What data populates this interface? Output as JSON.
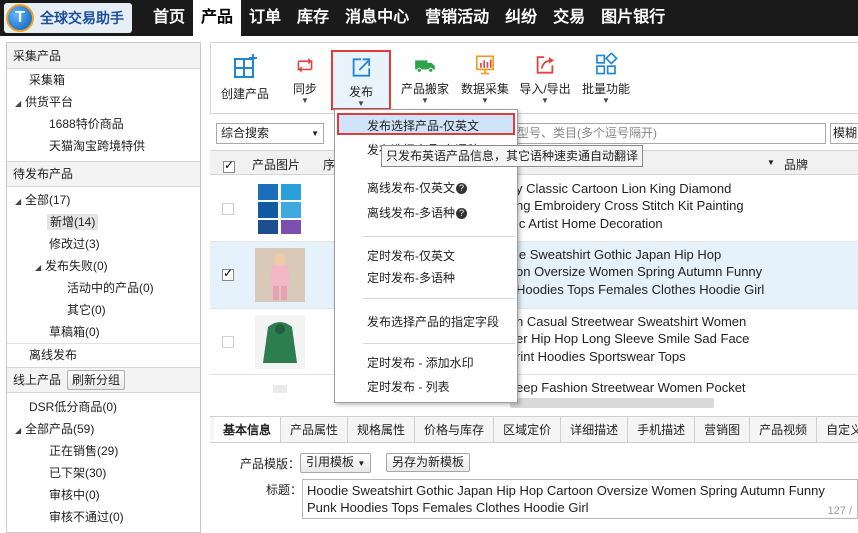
{
  "app": {
    "logo_text": "全球交易助手",
    "logo_mark": "T"
  },
  "nav": [
    "首页",
    "产品",
    "订单",
    "库存",
    "消息中心",
    "营销活动",
    "纠纷",
    "交易",
    "图片银行"
  ],
  "sidebar": {
    "collect_header": "采集产品",
    "collect_items": [
      "采集箱",
      "供货平台",
      "1688特价商品",
      "天猫淘宝跨境特供"
    ],
    "pending_header": "待发布产品",
    "pending_items": [
      "全部(17)",
      "新增(14)",
      "修改过(3)",
      "发布失败(0)",
      "活动中的产品(0)",
      "其它(0)",
      "草稿箱(0)"
    ],
    "offline": "离线发布",
    "online_header": "线上产品",
    "refresh_btn": "刷新分组",
    "online_items": [
      "DSR低分商品(0)",
      "全部产品(59)",
      "正在销售(29)",
      "已下架(30)",
      "审核中(0)",
      "审核不通过(0)"
    ]
  },
  "toolbar": {
    "create": "创建产品",
    "sync": "同步",
    "publish": "发布",
    "move": "产品搬家",
    "data_collect": "数据采集",
    "import_export": "导入/导出",
    "batch": "批量功能"
  },
  "search": {
    "type": "综合搜索",
    "placeholder_text": "型号、类目(多个逗号隔开)",
    "fuzzy": "模糊"
  },
  "table": {
    "col_image": "产品图片",
    "col_seq": "序",
    "col_brand": "品牌",
    "rows": [
      {
        "selected": false,
        "title": [
          "y Classic Cartoon Lion King Diamond",
          "ng Embroidery Cross Stitch Kit Painting",
          "ic Artist Home Decoration"
        ]
      },
      {
        "selected": true,
        "title": [
          "ie Sweatshirt Gothic Japan Hip Hop",
          "on Oversize Women Spring Autumn Funny",
          "Hoodies Tops Females Clothes Hoodie Girl"
        ]
      },
      {
        "selected": false,
        "title": [
          "n Casual Streetwear Sweatshirt Women",
          "er Hip Hop Long Sleeve Smile Sad Face",
          "rint Hoodies Sportswear Tops"
        ]
      },
      {
        "selected": false,
        "title": [
          "eep Fashion Streetwear Women Pocket",
          "",
          ""
        ]
      }
    ]
  },
  "menu": {
    "items": [
      "发布选择产品-仅英文",
      "发布选择产品-多语种",
      "离线发布-仅英文",
      "离线发布-多语种",
      "定时发布-仅英文",
      "定时发布-多语种",
      "发布选择产品的指定字段",
      "定时发布 - 添加水印",
      "定时发布 - 列表"
    ],
    "tooltip": "只发布英语产品信息，其它语种速卖通自动翻译"
  },
  "bottom": {
    "tabs": [
      "基本信息",
      "产品属性",
      "规格属性",
      "价格与库存",
      "区域定价",
      "详细描述",
      "手机描述",
      "营销图",
      "产品视频",
      "自定义信息"
    ],
    "template_label": "产品模版：",
    "template_btn": "引用模板",
    "save_template_btn": "另存为新模板",
    "title_label": "标题：",
    "title_value": "Hoodie Sweatshirt Gothic Japan Hip Hop Cartoon Oversize Women Spring Autumn Funny Punk Hoodies Tops Females Clothes Hoodie Girl",
    "char_count": "127 /"
  },
  "colors": {
    "topbar": "#1a1a1a",
    "highlight_border": "#e03a3a",
    "selected_row": "#e5f1fb",
    "icon_blue": "#1f86d6",
    "icon_red": "#e0463f",
    "icon_green": "#2ea14a",
    "icon_orange": "#f29a1a"
  }
}
